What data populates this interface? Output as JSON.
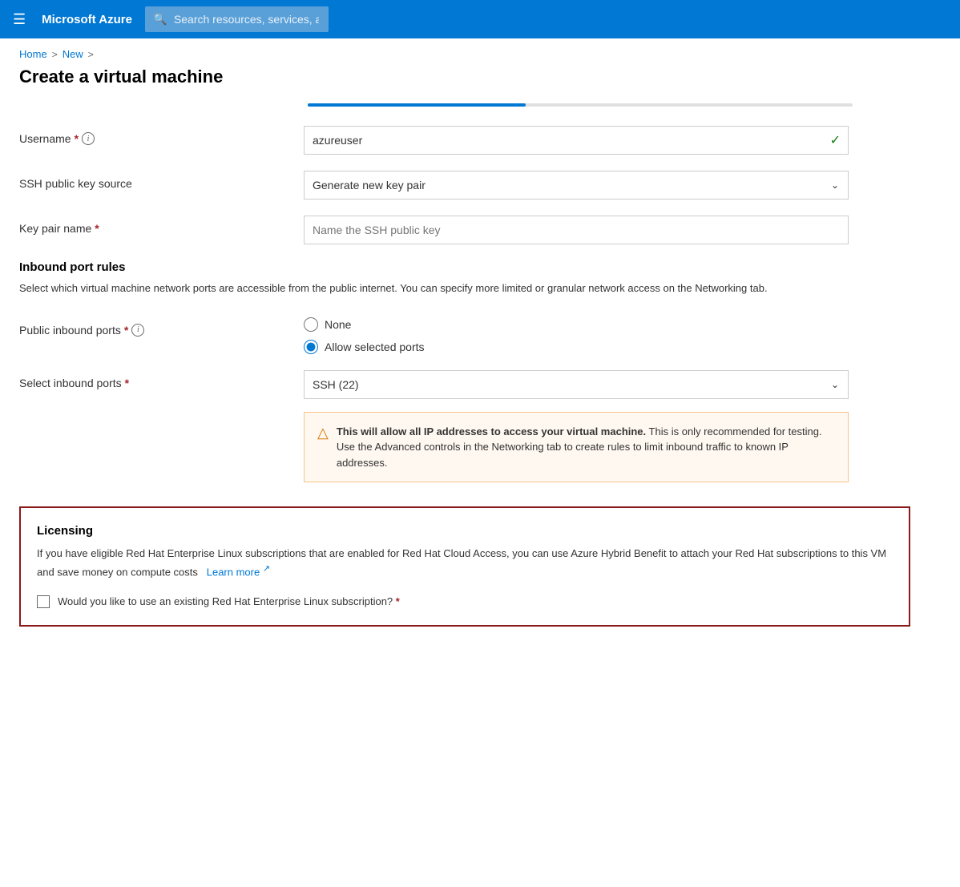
{
  "topbar": {
    "logo": "Microsoft Azure",
    "search_placeholder": "Search resources, services, and docs (G+/)"
  },
  "breadcrumb": {
    "home": "Home",
    "sep1": ">",
    "new": "New",
    "sep2": ">"
  },
  "page": {
    "title": "Create a virtual machine"
  },
  "form": {
    "username_label": "Username",
    "username_value": "azureuser",
    "ssh_source_label": "SSH public key source",
    "ssh_source_value": "Generate new key pair",
    "key_pair_label": "Key pair name",
    "key_pair_placeholder": "Name the SSH public key",
    "inbound_heading": "Inbound port rules",
    "inbound_desc": "Select which virtual machine network ports are accessible from the public internet. You can specify more limited or granular network access on the Networking tab.",
    "public_inbound_label": "Public inbound ports",
    "radio_none": "None",
    "radio_allow": "Allow selected ports",
    "select_inbound_label": "Select inbound ports",
    "select_inbound_value": "SSH (22)",
    "warning_text_bold": "This will allow all IP addresses to access your virtual machine.",
    "warning_text": " This is only recommended for testing.  Use the Advanced controls in the Networking tab to create rules to limit inbound traffic to known IP addresses.",
    "licensing_heading": "Licensing",
    "licensing_desc": "If you have eligible Red Hat Enterprise Linux subscriptions that are enabled for Red Hat Cloud Access, you can use Azure Hybrid Benefit to attach your Red Hat subscriptions to this VM and save money on compute costs",
    "learn_more": "Learn more",
    "checkbox_label": "Would you like to use an existing Red Hat Enterprise Linux subscription?",
    "required_star": "*"
  }
}
